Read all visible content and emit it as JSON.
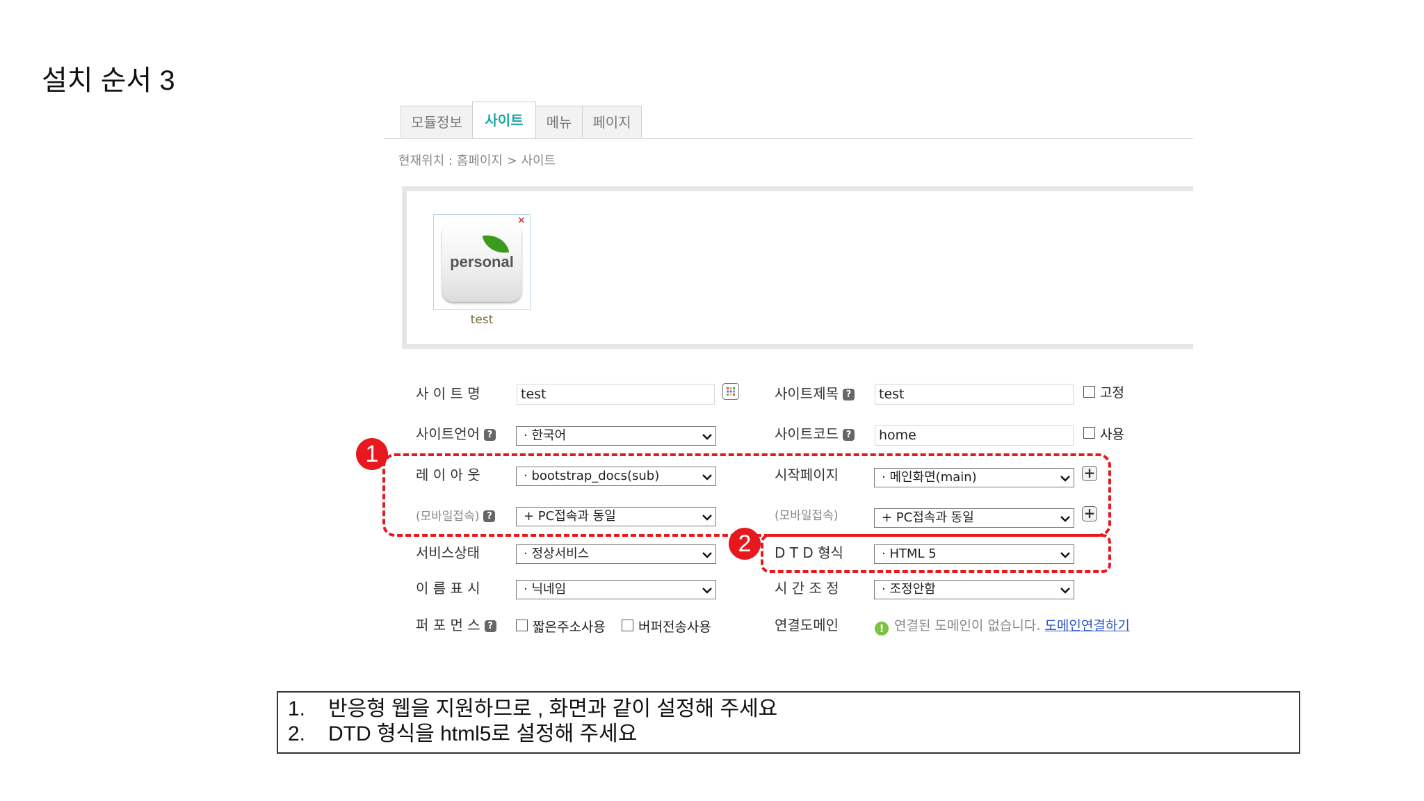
{
  "slide_title": "설치 순서 3",
  "tabs": [
    {
      "label": "모듈정보",
      "active": false
    },
    {
      "label": "사이트",
      "active": true
    },
    {
      "label": "메뉴",
      "active": false
    },
    {
      "label": "페이지",
      "active": false
    }
  ],
  "breadcrumb": "현재위치 : 홈페이지 > 사이트",
  "site_card": {
    "logo_text": "personal",
    "close_glyph": "×",
    "caption": "test"
  },
  "form": {
    "site_name": {
      "label": "사 이 트 명",
      "value": "test"
    },
    "site_title": {
      "label": "사이트제목",
      "value": "test",
      "checkbox": "고정"
    },
    "site_language": {
      "label": "사이트언어",
      "value": "· 한국어"
    },
    "site_code": {
      "label": "사이트코드",
      "value": "home",
      "checkbox": "사용"
    },
    "layout": {
      "label": "레 이 아 웃",
      "value": "· bootstrap_docs(sub)"
    },
    "start_page": {
      "label": "시작페이지",
      "value": "· 메인화면(main)"
    },
    "mobile_layout": {
      "label": "(모바일접속)",
      "value": "+ PC접속과 동일"
    },
    "mobile_start": {
      "label": "(모바일접속)",
      "value": "+ PC접속과 동일"
    },
    "service_status": {
      "label": "서비스상태",
      "value": "· 정상서비스"
    },
    "dtd_type": {
      "label": "D T D 형식",
      "value": "· HTML 5"
    },
    "name_display": {
      "label": "이 름 표 시",
      "value": "· 닉네임"
    },
    "time_adjust": {
      "label": "시 간 조 정",
      "value": "· 조정안함"
    },
    "performance": {
      "label": "퍼 포 먼 스",
      "options": [
        "짧은주소사용",
        "버퍼전송사용"
      ]
    },
    "linked_domain": {
      "label": "연결도메인",
      "info": "연결된 도메인이 없습니다.",
      "link": "도메인연결하기"
    }
  },
  "help_glyph": "?",
  "plus_glyph": "+",
  "ok_glyph": "!",
  "annotations": [
    {
      "number": "1",
      "color": "#e8181f"
    },
    {
      "number": "2",
      "color": "#e8181f"
    }
  ],
  "instructions": [
    {
      "num": "1.",
      "text": "반응형 웹을 지원하므로 , 화면과 같이 설정해 주세요"
    },
    {
      "num": "2.",
      "text": "DTD 형식을 html5로 설정해 주세요"
    }
  ]
}
